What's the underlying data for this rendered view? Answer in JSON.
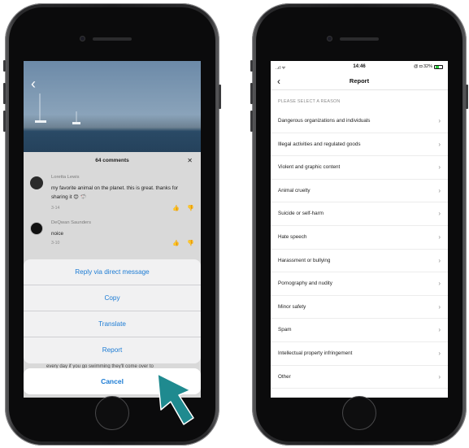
{
  "left_phone": {
    "comments": {
      "count_label": "64 comments",
      "close_label": "✕",
      "items": [
        {
          "name": "Loretta Lewis",
          "text": "my favorite animal on the planet. this is great. thanks for sharing it 😊 🦈",
          "date": "3-14"
        },
        {
          "name": "DeQwan Saunders",
          "text": "noice",
          "date": "3-10"
        }
      ]
    },
    "actions": [
      "Reply via direct message",
      "Copy",
      "Translate",
      "Report"
    ],
    "peek_text": "every day if you go swimming they'll come over to",
    "cancel_label": "Cancel"
  },
  "right_phone": {
    "status": {
      "signal": "..ıl ᯤ",
      "time": "14:46",
      "right": "@ ◘ 32%"
    },
    "title": "Report",
    "section_label": "PLEASE SELECT A REASON",
    "reasons": [
      "Dangerous organizations and individuals",
      "Illegal activities and regulated goods",
      "Violent and graphic content",
      "Animal cruelty",
      "Suicide or self-harm",
      "Hate speech",
      "Harassment or bullying",
      "Pornography and nudity",
      "Minor safety",
      "Spam",
      "Intellectual property infringement",
      "Other"
    ]
  },
  "colors": {
    "link_blue": "#1b7bd4",
    "pointer_teal": "#1f8a8f"
  }
}
